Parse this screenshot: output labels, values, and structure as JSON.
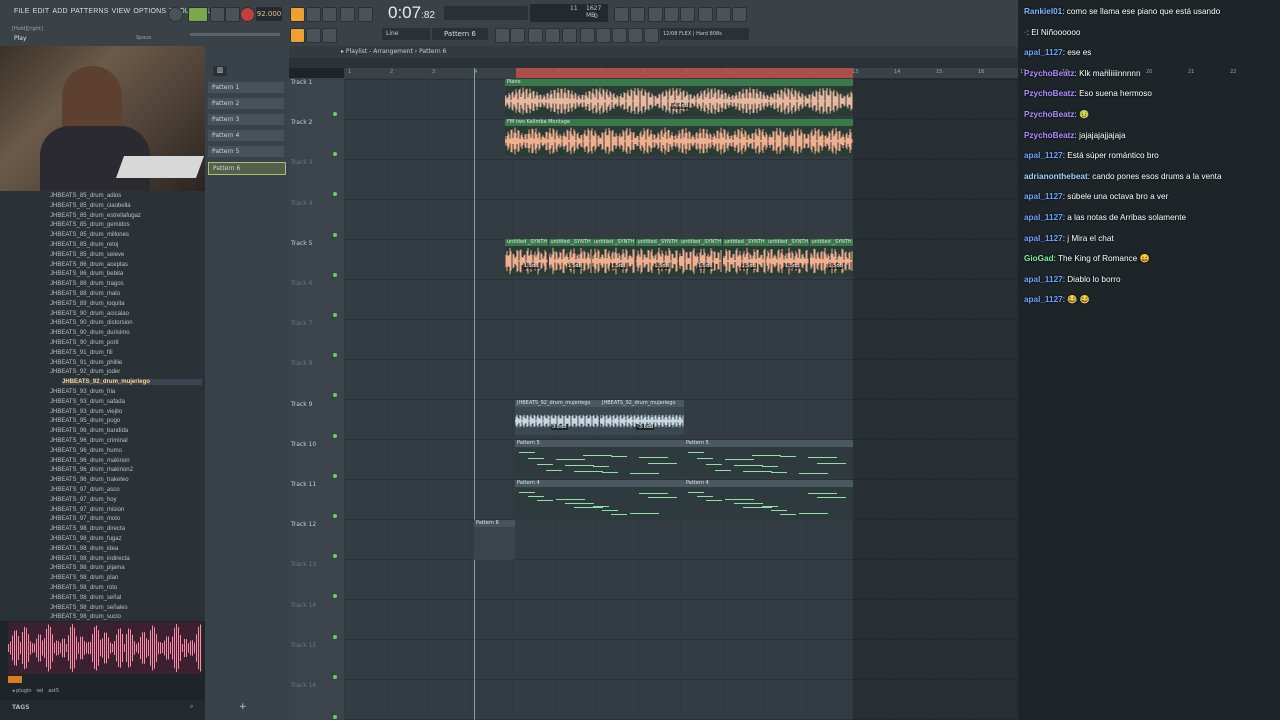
{
  "menu": {
    "items": [
      "FILE",
      "EDIT",
      "ADD",
      "PATTERNS",
      "VIEW",
      "OPTIONS",
      "TOOLS",
      "HELP"
    ]
  },
  "transport": {
    "tempo": "92.000",
    "time_main": "0:07",
    "time_sub": "82",
    "hint_title": "[Hold][right]",
    "hint_play": "Play",
    "hint_space": "Space",
    "cpu": "1627 MB",
    "cpu_top": "11",
    "cpu_bottom": "0"
  },
  "toolbar2": {
    "snap": "Line",
    "pattern_selector": "Pattern 6",
    "preset_label": "12/08 FLEX | Hard 808s"
  },
  "playlist": {
    "breadcrumb": "Playlist - Arrangement",
    "pattern": "Pattern 6"
  },
  "patterns": [
    "Pattern 1",
    "Pattern 2",
    "Pattern 3",
    "Pattern 4",
    "Pattern 5",
    "Pattern 6"
  ],
  "tracks": [
    "Track 1",
    "Track 2",
    "Track 3",
    "Track 4",
    "Track 5",
    "Track 6",
    "Track 7",
    "Track 8",
    "Track 9",
    "Track 10",
    "Track 11",
    "Track 12",
    "Track 13",
    "Track 14",
    "Track 15",
    "Track 16"
  ],
  "timeline": [
    "1",
    "2",
    "3",
    "4",
    "5",
    "6",
    "7",
    "8",
    "9",
    "10",
    "11",
    "12",
    "13",
    "14",
    "15",
    "16",
    "17",
    "18",
    "19",
    "20",
    "21",
    "22"
  ],
  "clips": {
    "piano": "Piano",
    "piano_db": "-4.4dB",
    "kalimba": "FM two Kalimba Montage",
    "synth": "untitled _SYNTH",
    "synth_db": "1.5dB",
    "drum": "JHBEATS_92_drum_mujeriego",
    "drum_db1": "3.8dB",
    "drum_db2": "-3.6dB",
    "p5": "Pattern 5",
    "p4": "Pattern 4",
    "p6": "Pattern 6"
  },
  "browser": [
    "JHBEATS_85_drum_adios",
    "JHBEATS_85_drum_ciaobella",
    "JHBEATS_85_drum_estrellafugaz",
    "JHBEATS_85_drum_gemidos",
    "JHBEATS_85_drum_millones",
    "JHBEATS_85_drum_reloj",
    "JHBEATS_85_drum_seieve",
    "JHBEATS_86_drum_aceptas",
    "JHBEATS_86_drum_bebita",
    "JHBEATS_86_drum_tragos",
    "JHBEATS_88_drum_malo",
    "JHBEATS_89_drum_loquita",
    "JHBEATS_90_drum_acicalao",
    "JHBEATS_90_drum_distorsion",
    "JHBEATS_90_drum_durisimo",
    "JHBEATS_90_drum_porti",
    "JHBEATS_91_drum_fili",
    "JHBEATS_91_drum_phillie",
    "JHBEATS_92_drum_joder",
    "JHBEATS_92_drum_mujeriego",
    "JHBEATS_93_drum_fria",
    "JHBEATS_93_drum_safada",
    "JHBEATS_93_drum_viejito",
    "JHBEATS_95_drum_pogo",
    "JHBEATS_96_drum_bandida",
    "JHBEATS_96_drum_criminal",
    "JHBEATS_96_drum_humo",
    "JHBEATS_96_drum_makinon",
    "JHBEATS_96_drum_makinon2",
    "JHBEATS_96_drum_traketeo",
    "JHBEATS_97_drum_asco",
    "JHBEATS_97_drum_hoy",
    "JHBEATS_97_drum_mision",
    "JHBEATS_97_drum_moto",
    "JHBEATS_98_drum_directa",
    "JHBEATS_98_drum_fugaz",
    "JHBEATS_98_drum_idea",
    "JHBEATS_98_drum_indirecta",
    "JHBEATS_98_drum_pijama",
    "JHBEATS_98_drum_plan",
    "JHBEATS_98_drum_roto",
    "JHBEATS_98_drum_señal",
    "JHBEATS_98_drum_señales",
    "JHBEATS_98_drum_sucio"
  ],
  "browser_selected": 19,
  "bottom": {
    "tags": "TAGS",
    "plugin": "plugin",
    "sel": "sel",
    "ast": "ast5"
  },
  "chat": [
    {
      "user": "Rankiel01",
      "color": "#7fb3ff",
      "text": ": como se llama ese piano que está usando"
    },
    {
      "user": "·",
      "color": "#4a74c4",
      "text": ": El Niñoooooo"
    },
    {
      "user": "apal_1127",
      "color": "#6fa0ff",
      "text": ": ese es"
    },
    {
      "user": "PzychoBeatz",
      "color": "#b08cff",
      "text": ": Klk maniiiiinnnnn"
    },
    {
      "user": "PzychoBeatz",
      "color": "#b08cff",
      "text": ": Eso suena hermoso"
    },
    {
      "user": "PzychoBeatz",
      "color": "#b08cff",
      "text": ": 🤢"
    },
    {
      "user": "PzychoBeatz",
      "color": "#b08cff",
      "text": ": jajajajajjajaja"
    },
    {
      "user": "apal_1127",
      "color": "#6fa0ff",
      "text": ": Está súper romántico bro"
    },
    {
      "user": "adrianonthebeat",
      "color": "#9fd0ff",
      "text": ": cando pones esos drums a la venta"
    },
    {
      "user": "apal_1127",
      "color": "#6fa0ff",
      "text": ": súbele una octava bro a ver"
    },
    {
      "user": "apal_1127",
      "color": "#6fa0ff",
      "text": ": a las notas de Arribas solamente"
    },
    {
      "user": "apal_1127",
      "color": "#6fa0ff",
      "text": ": j Mira el chat"
    },
    {
      "user": "GioGad",
      "color": "#7cf0a0",
      "text": ": The King of Romance 😄"
    },
    {
      "user": "apal_1127",
      "color": "#6fa0ff",
      "text": ": Diablo lo borro"
    },
    {
      "user": "apal_1127",
      "color": "#6fa0ff",
      "text": ": 😂 😂"
    }
  ]
}
